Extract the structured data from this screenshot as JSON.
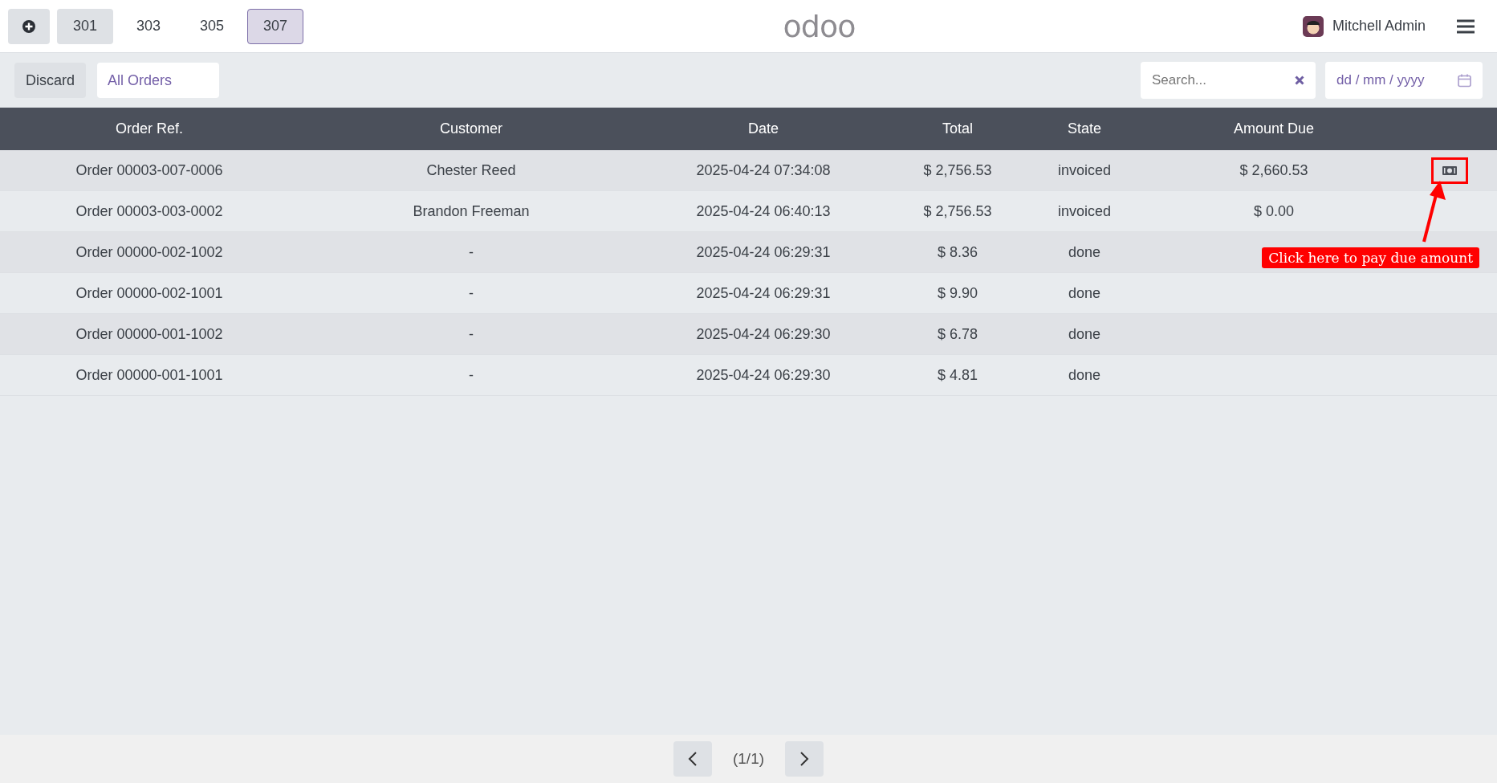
{
  "top_bar": {
    "tabs": [
      {
        "label": "301",
        "selected": false,
        "shaded": true
      },
      {
        "label": "303",
        "selected": false,
        "shaded": false
      },
      {
        "label": "305",
        "selected": false,
        "shaded": false
      },
      {
        "label": "307",
        "selected": true,
        "shaded": true
      }
    ],
    "logo": "odoo",
    "user": "Mitchell Admin"
  },
  "toolbar": {
    "discard": "Discard",
    "filter": "All Orders",
    "search": {
      "placeholder": "Search..."
    },
    "date": {
      "placeholder": "dd / mm / yyyy"
    }
  },
  "table": {
    "columns": [
      "Order Ref.",
      "Customer",
      "Date",
      "Total",
      "State",
      "Amount Due"
    ],
    "rows": [
      {
        "cells": [
          "Order 00003-007-0006",
          "Chester Reed",
          "2025-04-24 07:34:08",
          "$ 2,756.53",
          "invoiced",
          "$ 2,660.53"
        ],
        "pay_button": true
      },
      {
        "cells": [
          "Order 00003-003-0002",
          "Brandon Freeman",
          "2025-04-24 06:40:13",
          "$ 2,756.53",
          "invoiced",
          "$ 0.00"
        ],
        "pay_button": false
      },
      {
        "cells": [
          "Order 00000-002-1002",
          "-",
          "2025-04-24 06:29:31",
          "$ 8.36",
          "done"
        ],
        "pay_button": false
      },
      {
        "cells": [
          "Order 00000-002-1001",
          "-",
          "2025-04-24 06:29:31",
          "$ 9.90",
          "done"
        ],
        "pay_button": false
      },
      {
        "cells": [
          "Order 00000-001-1002",
          "-",
          "2025-04-24 06:29:30",
          "$ 6.78",
          "done"
        ],
        "pay_button": false
      },
      {
        "cells": [
          "Order 00000-001-1001",
          "-",
          "2025-04-24 06:29:30",
          "$ 4.81",
          "done"
        ],
        "pay_button": false
      }
    ]
  },
  "annotation": {
    "text": "Click here to pay due amount"
  },
  "pager": {
    "label": "(1/1)"
  }
}
